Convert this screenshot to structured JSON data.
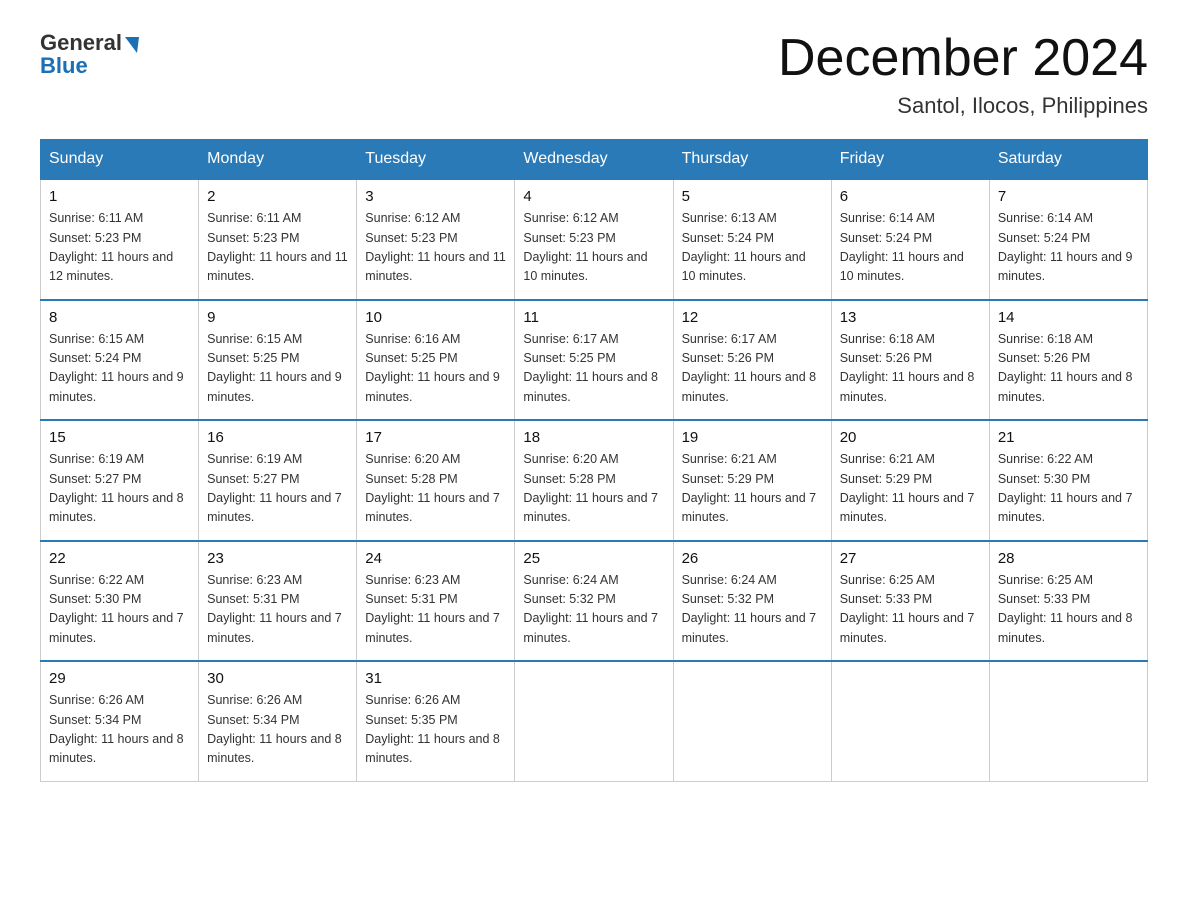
{
  "header": {
    "logo_general": "General",
    "logo_blue": "Blue",
    "title": "December 2024",
    "subtitle": "Santol, Ilocos, Philippines"
  },
  "days_of_week": [
    "Sunday",
    "Monday",
    "Tuesday",
    "Wednesday",
    "Thursday",
    "Friday",
    "Saturday"
  ],
  "weeks": [
    [
      {
        "day": "1",
        "sunrise": "6:11 AM",
        "sunset": "5:23 PM",
        "daylight": "11 hours and 12 minutes."
      },
      {
        "day": "2",
        "sunrise": "6:11 AM",
        "sunset": "5:23 PM",
        "daylight": "11 hours and 11 minutes."
      },
      {
        "day": "3",
        "sunrise": "6:12 AM",
        "sunset": "5:23 PM",
        "daylight": "11 hours and 11 minutes."
      },
      {
        "day": "4",
        "sunrise": "6:12 AM",
        "sunset": "5:23 PM",
        "daylight": "11 hours and 10 minutes."
      },
      {
        "day": "5",
        "sunrise": "6:13 AM",
        "sunset": "5:24 PM",
        "daylight": "11 hours and 10 minutes."
      },
      {
        "day": "6",
        "sunrise": "6:14 AM",
        "sunset": "5:24 PM",
        "daylight": "11 hours and 10 minutes."
      },
      {
        "day": "7",
        "sunrise": "6:14 AM",
        "sunset": "5:24 PM",
        "daylight": "11 hours and 9 minutes."
      }
    ],
    [
      {
        "day": "8",
        "sunrise": "6:15 AM",
        "sunset": "5:24 PM",
        "daylight": "11 hours and 9 minutes."
      },
      {
        "day": "9",
        "sunrise": "6:15 AM",
        "sunset": "5:25 PM",
        "daylight": "11 hours and 9 minutes."
      },
      {
        "day": "10",
        "sunrise": "6:16 AM",
        "sunset": "5:25 PM",
        "daylight": "11 hours and 9 minutes."
      },
      {
        "day": "11",
        "sunrise": "6:17 AM",
        "sunset": "5:25 PM",
        "daylight": "11 hours and 8 minutes."
      },
      {
        "day": "12",
        "sunrise": "6:17 AM",
        "sunset": "5:26 PM",
        "daylight": "11 hours and 8 minutes."
      },
      {
        "day": "13",
        "sunrise": "6:18 AM",
        "sunset": "5:26 PM",
        "daylight": "11 hours and 8 minutes."
      },
      {
        "day": "14",
        "sunrise": "6:18 AM",
        "sunset": "5:26 PM",
        "daylight": "11 hours and 8 minutes."
      }
    ],
    [
      {
        "day": "15",
        "sunrise": "6:19 AM",
        "sunset": "5:27 PM",
        "daylight": "11 hours and 8 minutes."
      },
      {
        "day": "16",
        "sunrise": "6:19 AM",
        "sunset": "5:27 PM",
        "daylight": "11 hours and 7 minutes."
      },
      {
        "day": "17",
        "sunrise": "6:20 AM",
        "sunset": "5:28 PM",
        "daylight": "11 hours and 7 minutes."
      },
      {
        "day": "18",
        "sunrise": "6:20 AM",
        "sunset": "5:28 PM",
        "daylight": "11 hours and 7 minutes."
      },
      {
        "day": "19",
        "sunrise": "6:21 AM",
        "sunset": "5:29 PM",
        "daylight": "11 hours and 7 minutes."
      },
      {
        "day": "20",
        "sunrise": "6:21 AM",
        "sunset": "5:29 PM",
        "daylight": "11 hours and 7 minutes."
      },
      {
        "day": "21",
        "sunrise": "6:22 AM",
        "sunset": "5:30 PM",
        "daylight": "11 hours and 7 minutes."
      }
    ],
    [
      {
        "day": "22",
        "sunrise": "6:22 AM",
        "sunset": "5:30 PM",
        "daylight": "11 hours and 7 minutes."
      },
      {
        "day": "23",
        "sunrise": "6:23 AM",
        "sunset": "5:31 PM",
        "daylight": "11 hours and 7 minutes."
      },
      {
        "day": "24",
        "sunrise": "6:23 AM",
        "sunset": "5:31 PM",
        "daylight": "11 hours and 7 minutes."
      },
      {
        "day": "25",
        "sunrise": "6:24 AM",
        "sunset": "5:32 PM",
        "daylight": "11 hours and 7 minutes."
      },
      {
        "day": "26",
        "sunrise": "6:24 AM",
        "sunset": "5:32 PM",
        "daylight": "11 hours and 7 minutes."
      },
      {
        "day": "27",
        "sunrise": "6:25 AM",
        "sunset": "5:33 PM",
        "daylight": "11 hours and 7 minutes."
      },
      {
        "day": "28",
        "sunrise": "6:25 AM",
        "sunset": "5:33 PM",
        "daylight": "11 hours and 8 minutes."
      }
    ],
    [
      {
        "day": "29",
        "sunrise": "6:26 AM",
        "sunset": "5:34 PM",
        "daylight": "11 hours and 8 minutes."
      },
      {
        "day": "30",
        "sunrise": "6:26 AM",
        "sunset": "5:34 PM",
        "daylight": "11 hours and 8 minutes."
      },
      {
        "day": "31",
        "sunrise": "6:26 AM",
        "sunset": "5:35 PM",
        "daylight": "11 hours and 8 minutes."
      },
      null,
      null,
      null,
      null
    ]
  ]
}
